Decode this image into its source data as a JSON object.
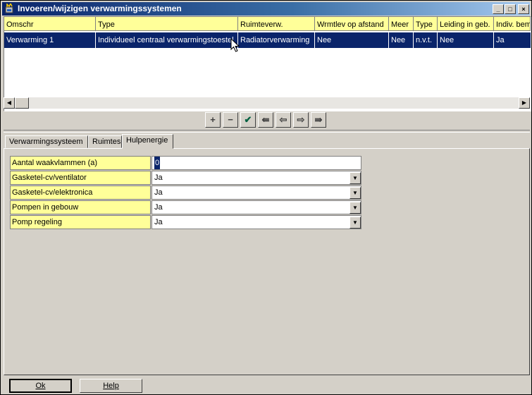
{
  "window": {
    "title": "Invoeren/wijzigen verwarmingssystemen",
    "controls": {
      "minimize": "_",
      "maximize": "□",
      "close": "×"
    }
  },
  "grid": {
    "columns": [
      "Omschr",
      "Type",
      "Ruimteverw.",
      "Wrmtlev op afstand",
      "Meer",
      "Type",
      "Leiding in geb.",
      "Indiv. bem"
    ],
    "rows": [
      [
        "Verwarming 1",
        "Individueel centraal verwarmingstoestel",
        "Radiatorverwarming",
        "Nee",
        "Nee",
        "n.v.t.",
        "Nee",
        "Ja"
      ]
    ]
  },
  "navigator": {
    "icons": [
      "plus-icon",
      "minus-icon",
      "check-icon",
      "first-icon",
      "prior-icon",
      "next-icon",
      "last-icon"
    ],
    "glyphs": [
      "+",
      "−",
      "✔",
      "⇚",
      "⇦",
      "⇨",
      "⇛"
    ]
  },
  "tabs": [
    "Verwarmingssysteem",
    "Ruimtes",
    "Hulpenergie"
  ],
  "active_tab": "Hulpenergie",
  "form": {
    "fields": [
      {
        "label": "Aantal waakvlammen (a)",
        "value": "0"
      },
      {
        "label": "Gasketel-cv/ventilator",
        "value": "Ja"
      },
      {
        "label": "Gasketel-cv/elektronica",
        "value": "Ja"
      },
      {
        "label": "Pompen in gebouw",
        "value": "Ja"
      },
      {
        "label": "Pomp regeling",
        "value": "Ja"
      }
    ]
  },
  "buttons": {
    "ok": "Ok",
    "help": "Help"
  },
  "colors": {
    "title_start": "#0a246a",
    "header_bg": "#ffff99",
    "selection": "#0a246a",
    "face": "#d4d0c8"
  }
}
